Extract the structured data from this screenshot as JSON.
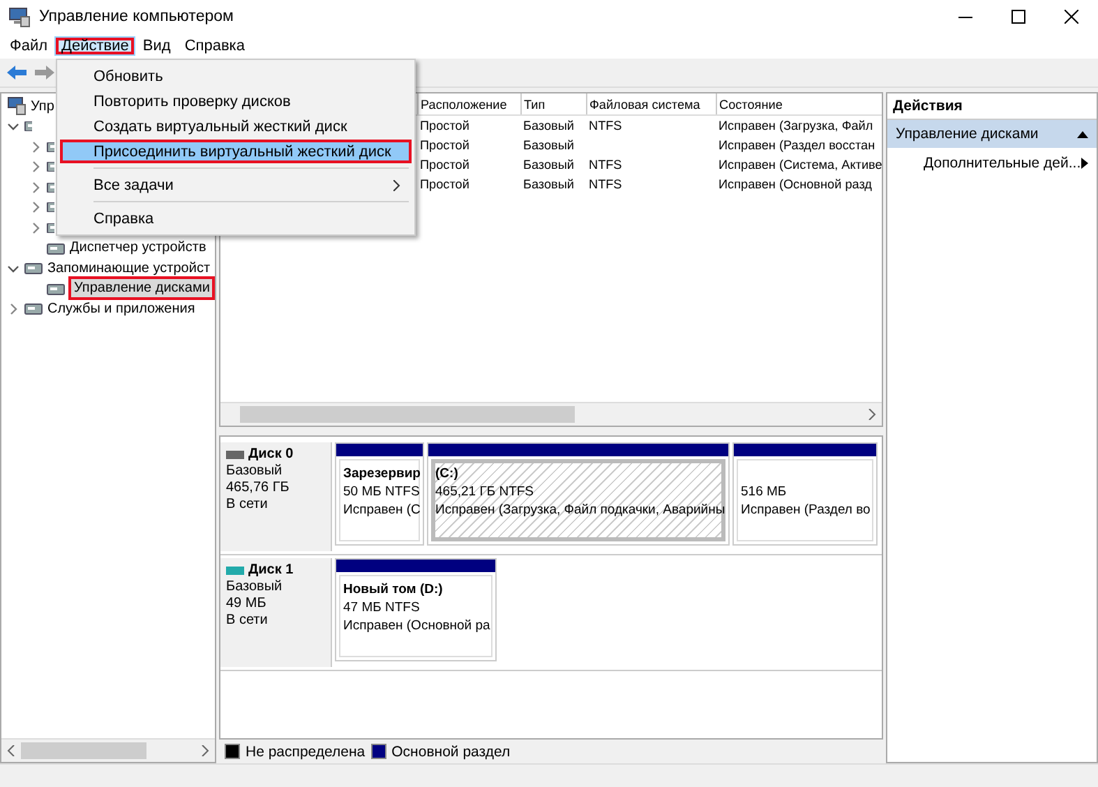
{
  "window": {
    "title": "Управление компьютером"
  },
  "menu_bar": [
    {
      "label": "Файл",
      "open": false,
      "highlighted": false
    },
    {
      "label": "Действие",
      "open": true,
      "highlighted": true
    },
    {
      "label": "Вид",
      "open": false,
      "highlighted": false
    },
    {
      "label": "Справка",
      "open": false,
      "highlighted": false
    }
  ],
  "context_menu": {
    "items": [
      {
        "kind": "item",
        "label": "Обновить",
        "selected": false,
        "highlighted": false
      },
      {
        "kind": "item",
        "label": "Повторить проверку дисков",
        "selected": false,
        "highlighted": false
      },
      {
        "kind": "item",
        "label": "Создать виртуальный жесткий диск",
        "selected": false,
        "highlighted": false
      },
      {
        "kind": "item",
        "label": "Присоединить виртуальный жесткий диск",
        "selected": true,
        "highlighted": true
      },
      {
        "kind": "separator"
      },
      {
        "kind": "submenu",
        "label": "Все задачи",
        "selected": false,
        "highlighted": false
      },
      {
        "kind": "separator"
      },
      {
        "kind": "item",
        "label": "Справка",
        "selected": false,
        "highlighted": false
      }
    ]
  },
  "tree": [
    {
      "label": "Упр",
      "selected": false,
      "children": [
        {
          "expanded": true,
          "children": [
            {
              "expanded": false
            },
            {
              "expanded": false
            },
            {
              "expanded": false
            },
            {
              "expanded": false
            },
            {
              "expanded": false
            },
            {
              "label": "Диспетчер устройств",
              "selected": false,
              "highlighted": false
            }
          ]
        },
        {
          "label": "Запоминающие устройст",
          "expanded": true,
          "selected": false,
          "highlighted": false,
          "children": [
            {
              "label": "Управление дисками",
              "selected": true,
              "highlighted": true
            }
          ]
        },
        {
          "label": "Службы и приложения",
          "expanded": false,
          "selected": false,
          "highlighted": false
        }
      ]
    }
  ],
  "table": {
    "columns": [
      "Расположение",
      "Тип",
      "Файловая система",
      "Состояние"
    ],
    "rows": [
      {
        "location": "Простой",
        "type": "Базовый",
        "file_system": "NTFS",
        "status": "Исправен (Загрузка, Файл"
      },
      {
        "location": "Простой",
        "type": "Базовый",
        "status": "Исправен (Раздел восстан"
      },
      {
        "location": "Простой",
        "type": "Базовый",
        "file_system": "NTFS",
        "status": "Исправен (Система, Активе"
      },
      {
        "location": "Простой",
        "type": "Базовый",
        "file_system": "NTFS",
        "status": "Исправен (Основной разд"
      }
    ]
  },
  "disks": [
    {
      "name": "Диск 0",
      "type": "Базовый",
      "size": "465,76 ГБ",
      "state": "В сети",
      "partitions": [
        {
          "name": "Зарезервир",
          "size": "50 МБ NTFS",
          "status": "Исправен (С",
          "selected": false
        },
        {
          "name": "(C:)",
          "size": "465,21 ГБ NTFS",
          "status": "Исправен (Загрузка, Файл подкачки, Аварийны",
          "selected": true
        },
        {
          "size": "516 МБ",
          "status": "Исправен (Раздел во",
          "selected": false
        }
      ]
    },
    {
      "name": "Диск 1",
      "type": "Базовый",
      "size": "49 МБ",
      "state": "В сети",
      "partitions": [
        {
          "name": "Новый том  (D:)",
          "size": "47 МБ NTFS",
          "status": "Исправен (Основной ра",
          "selected": false
        }
      ]
    }
  ],
  "legend": [
    {
      "label": "Не распределена",
      "color": "#000000"
    },
    {
      "label": "Основной раздел",
      "color": "#000080"
    }
  ],
  "actions": {
    "title": "Действия",
    "sections": [
      {
        "title": "Управление дисками",
        "expanded": true,
        "items": [
          {
            "label": "Дополнительные дей...",
            "has_submenu": true
          }
        ]
      }
    ]
  }
}
